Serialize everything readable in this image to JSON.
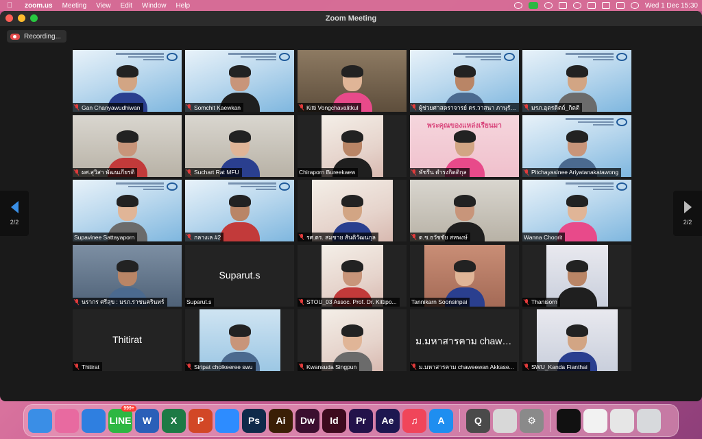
{
  "menubar": {
    "app_name": "zoom.us",
    "menus": [
      "Meeting",
      "View",
      "Edit",
      "Window",
      "Help"
    ],
    "clock": "Wed 1 Dec  15:30",
    "status_icons": [
      "camera-icon",
      "line-icon",
      "sync-icon",
      "battery-icon",
      "wifi-icon",
      "keyboard-icon",
      "display-icon",
      "control-center-icon",
      "siri-icon"
    ]
  },
  "window": {
    "title": "Zoom Meeting",
    "recording_label": "Recording...",
    "page_indicator": "2/2"
  },
  "participants": [
    {
      "name": "Gan Chanyawudhiwan",
      "bg": "slide",
      "muted": true
    },
    {
      "name": "Somchit Kaewkan",
      "bg": "slide",
      "muted": true
    },
    {
      "name": "Kitti Vongchavalitkul",
      "bg": "room",
      "muted": true
    },
    {
      "name": "ผู้ช่วยศาสตราจารย์ ดร.วาสนา ภานุรักษ์",
      "bg": "slide",
      "muted": true
    },
    {
      "name": "มรภ.อุตรดิตถ์_กิตติ",
      "bg": "slide",
      "muted": true
    },
    {
      "name": "ผศ.สุวิสา พัฒนเกียรติ",
      "bg": "office",
      "muted": true
    },
    {
      "name": "Suchart Rat MFU",
      "bg": "office",
      "muted": true
    },
    {
      "name": "Chiraporn Bureekaew",
      "bg": "dark",
      "muted": false
    },
    {
      "name": "พัชรีน ดำรงกิตติกุล",
      "bg": "pink",
      "muted": true,
      "banner": "พระคุณของแหล่งเรียนมา"
    },
    {
      "name": "Pitchayasinee Ariyatanakatawong",
      "bg": "slide",
      "muted": true
    },
    {
      "name": "Supavinee Sattayaporn",
      "bg": "slide",
      "muted": false
    },
    {
      "name": "กลางเล #2",
      "bg": "slide",
      "muted": true
    },
    {
      "name": "รศ.ดร. สมชาย สันติวัฒนกุล",
      "bg": "dark",
      "muted": true
    },
    {
      "name": "ด.ช.ธวัชชัย สหพงษ์",
      "bg": "office",
      "muted": true
    },
    {
      "name": "Wanna Choorit",
      "bg": "slide",
      "muted": false
    },
    {
      "name": "นรากร ศรีสุข : มรภ.ราชนครินทร์",
      "bg": "shelf",
      "muted": true
    },
    {
      "name": "Suparut.s",
      "bg": "dark",
      "muted": false,
      "display_name": "Suparut.s"
    },
    {
      "name": "STOU_03 Assoc. Prof. Dr. Kittipo...",
      "bg": "dark",
      "muted": true
    },
    {
      "name": "Tannikarn Soonsinpai",
      "bg": "dark",
      "muted": false
    },
    {
      "name": "Thanisorn",
      "bg": "dark",
      "muted": true
    },
    {
      "name": "Thitirat",
      "bg": "dark",
      "muted": true,
      "display_name": "Thitirat"
    },
    {
      "name": "Siripat cholkeeree swu",
      "bg": "dark",
      "muted": true
    },
    {
      "name": "Kwansuda Singpun",
      "bg": "dark",
      "muted": true
    },
    {
      "name": "ม.มหาสารคาม chaweewan Akkase...",
      "bg": "dark",
      "muted": true,
      "display_name": "ม.มหาสารคาม chawe..."
    },
    {
      "name": "SWU_Kanda Fianthai",
      "bg": "dark",
      "muted": true
    }
  ],
  "dock": {
    "apps": [
      {
        "name": "finder",
        "icon": "finder-icon",
        "color": "#3a8ee6",
        "text": ""
      },
      {
        "name": "launchpad",
        "icon": "launchpad-icon",
        "color": "#e86aa0",
        "text": ""
      },
      {
        "name": "safari",
        "icon": "safari-icon",
        "color": "#2f7fe0",
        "text": ""
      },
      {
        "name": "line",
        "icon": "line-icon",
        "color": "#2db742",
        "text": "LINE",
        "badge": "999+"
      },
      {
        "name": "word",
        "icon": "word-icon",
        "color": "#2b5fb8",
        "text": "W"
      },
      {
        "name": "excel",
        "icon": "excel-icon",
        "color": "#1d7a45",
        "text": "X"
      },
      {
        "name": "powerpoint",
        "icon": "powerpoint-icon",
        "color": "#d24726",
        "text": "P"
      },
      {
        "name": "zoom",
        "icon": "zoom-icon",
        "color": "#2d8cff",
        "text": ""
      },
      {
        "name": "photoshop",
        "icon": "photoshop-icon",
        "color": "#0f2a4a",
        "text": "Ps"
      },
      {
        "name": "illustrator",
        "icon": "illustrator-icon",
        "color": "#3a1f06",
        "text": "Ai"
      },
      {
        "name": "dreamweaver",
        "icon": "dreamweaver-icon",
        "color": "#3b0f2f",
        "text": "Dw"
      },
      {
        "name": "indesign",
        "icon": "indesign-icon",
        "color": "#3d0a1e",
        "text": "Id"
      },
      {
        "name": "premiere",
        "icon": "premiere-icon",
        "color": "#23124a",
        "text": "Pr"
      },
      {
        "name": "after-effects",
        "icon": "after-effects-icon",
        "color": "#1d1750",
        "text": "Ae"
      },
      {
        "name": "music",
        "icon": "music-icon",
        "color": "#f0455a",
        "text": "♫"
      },
      {
        "name": "app-store",
        "icon": "app-store-icon",
        "color": "#1e8ef0",
        "text": "A"
      },
      {
        "name": "quicktime",
        "icon": "quicktime-icon",
        "color": "#4a4a4a",
        "text": "Q"
      },
      {
        "name": "acrobat",
        "icon": "acrobat-icon",
        "color": "#d8d8d8",
        "text": ""
      },
      {
        "name": "system-preferences",
        "icon": "gear-icon",
        "color": "#8a8a8a",
        "text": "⚙"
      },
      {
        "name": "screenshot",
        "icon": "window-icon",
        "color": "#111111",
        "text": ""
      },
      {
        "name": "document-1",
        "icon": "document-icon",
        "color": "#f2f2f2",
        "text": ""
      },
      {
        "name": "document-2",
        "icon": "document-icon",
        "color": "#e6e6e6",
        "text": ""
      },
      {
        "name": "trash",
        "icon": "trash-icon",
        "color": "#d7d9dc",
        "text": ""
      }
    ]
  }
}
